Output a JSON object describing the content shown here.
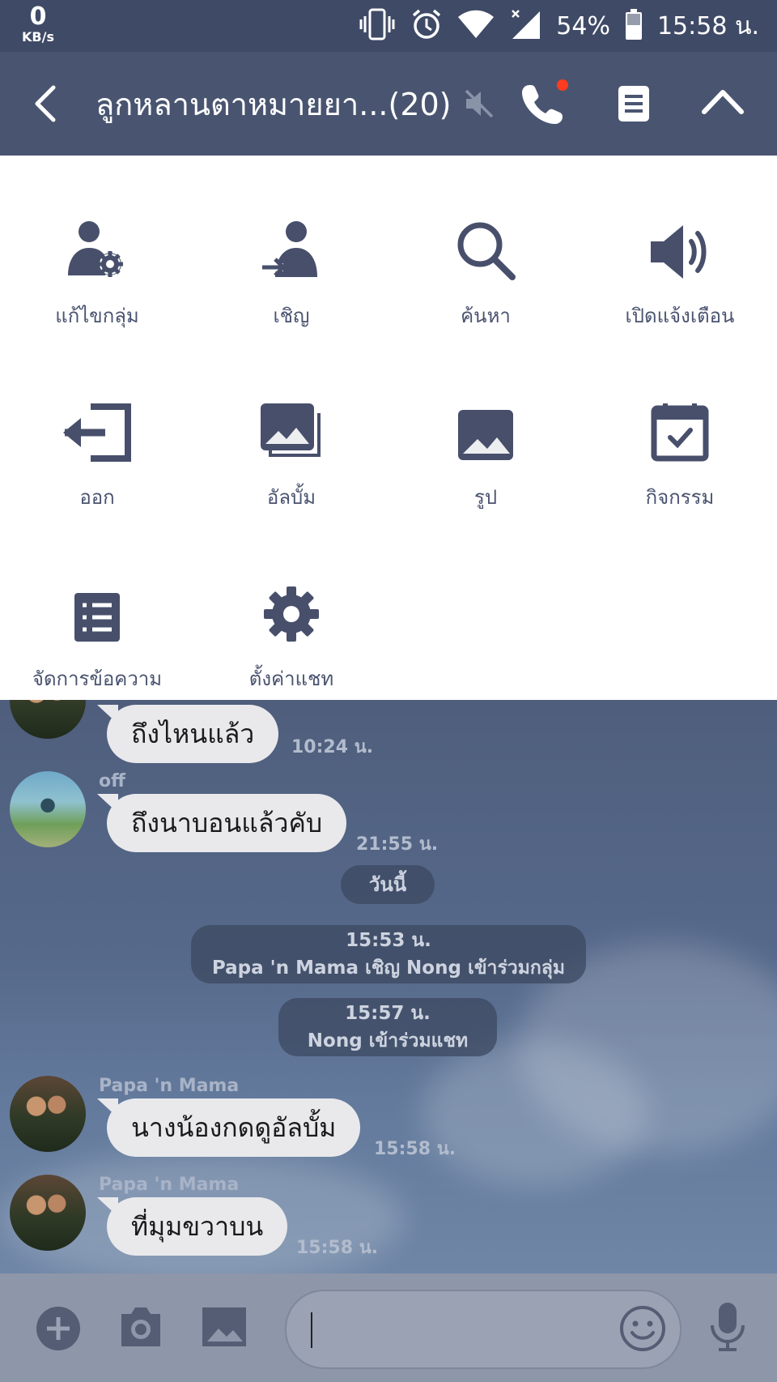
{
  "status_bar": {
    "speed_value": "0",
    "speed_unit": "KB/s",
    "battery": "54%",
    "time": "15:58 น."
  },
  "header": {
    "title": "ลูกหลานตาหมายยา...(20)"
  },
  "menu": {
    "items": [
      {
        "label": "แก้ไขกลุ่ม",
        "icon": "edit-group-icon"
      },
      {
        "label": "เชิญ",
        "icon": "invite-icon"
      },
      {
        "label": "ค้นหา",
        "icon": "search-icon"
      },
      {
        "label": "เปิดแจ้งเตือน",
        "icon": "speaker-icon"
      },
      {
        "label": "ออก",
        "icon": "leave-icon"
      },
      {
        "label": "อัลบั้ม",
        "icon": "album-icon"
      },
      {
        "label": "รูป",
        "icon": "photo-icon"
      },
      {
        "label": "กิจกรรม",
        "icon": "calendar-icon"
      },
      {
        "label": "จัดการข้อความ",
        "icon": "list-icon"
      },
      {
        "label": "ตั้งค่าแชท",
        "icon": "gear-icon"
      }
    ]
  },
  "chat": {
    "messages": [
      {
        "sender": "",
        "text": "ถึงไหนแล้ว",
        "time": "10:24 น."
      },
      {
        "sender": "off",
        "text": "ถึงนาบอนแล้วคับ",
        "time": "21:55 น."
      },
      {
        "sender": "Papa 'n Mama",
        "text": "นางน้องกดดูอัลบั้ม",
        "time": "15:58 น."
      },
      {
        "sender": "Papa 'n Mama",
        "text": "ที่มุมขวาบน",
        "time": "15:58 น."
      }
    ],
    "date_separator": "วันนี้",
    "system_messages": [
      {
        "time": "15:53 น.",
        "text": "Papa 'n Mama เชิญ Nong เข้าร่วมกลุ่ม"
      },
      {
        "time": "15:57 น.",
        "text": "Nong เข้าร่วมแชท"
      }
    ]
  },
  "input_bar": {
    "message_value": ""
  },
  "colors": {
    "header": "#495570",
    "status_bar": "#3f4a66",
    "menu_icon": "#474f6b",
    "bubble": "#e9e9ec",
    "call_badge": "#ff3b20"
  }
}
